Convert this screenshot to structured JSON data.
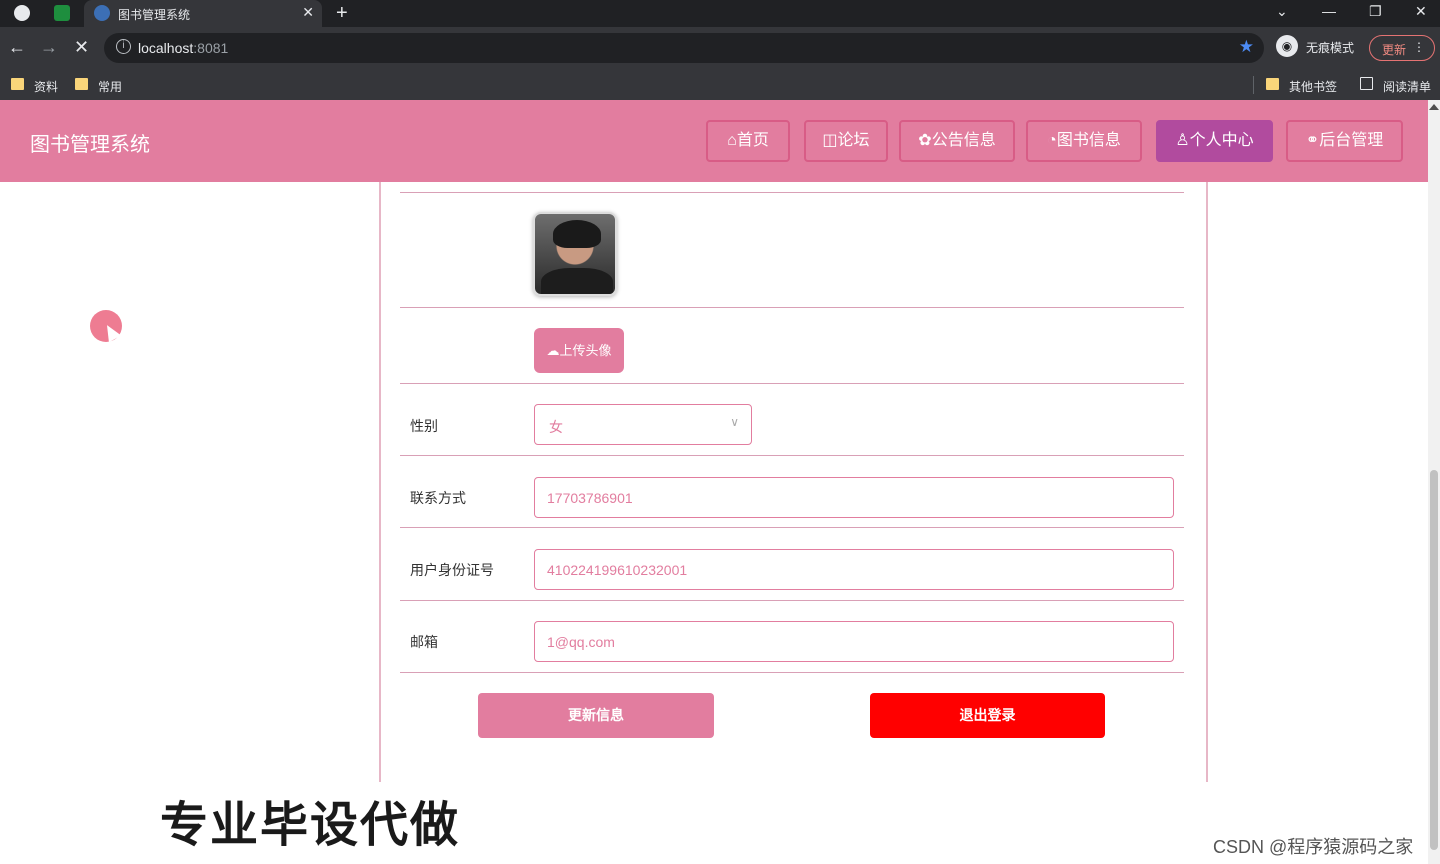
{
  "browser": {
    "tab_title": "图书管理系统",
    "new_tab": "+",
    "url_host": "localhost",
    "url_port": ":8081",
    "incognito_label": "无痕模式",
    "update_label": "更新",
    "bookmarks": [
      "资料",
      "常用"
    ],
    "bookmarks_right": [
      "其他书签",
      "阅读清单"
    ]
  },
  "header": {
    "site_title": "图书管理系统",
    "nav": [
      {
        "label": "首页",
        "active": false
      },
      {
        "label": "论坛",
        "active": false
      },
      {
        "label": "公告信息",
        "active": false
      },
      {
        "label": "图书信息",
        "active": false
      },
      {
        "label": "个人中心",
        "active": true
      },
      {
        "label": "后台管理",
        "active": false
      }
    ]
  },
  "profile": {
    "upload_label": "上传头像",
    "fields": {
      "gender": {
        "label": "性别",
        "value": "女"
      },
      "phone": {
        "label": "联系方式",
        "value": "17703786901"
      },
      "id_number": {
        "label": "用户身份证号",
        "value": "410224199610232001"
      },
      "email": {
        "label": "邮箱",
        "value": "1@qq.com"
      }
    },
    "update_button": "更新信息",
    "logout_button": "退出登录"
  },
  "overlay": {
    "promo_text": "专业毕设代做",
    "csdn_text": "CSDN @程序猿源码之家"
  },
  "colors": {
    "primary": "#e27d9f",
    "active_nav": "#b14b9e",
    "danger": "#ff0000"
  }
}
